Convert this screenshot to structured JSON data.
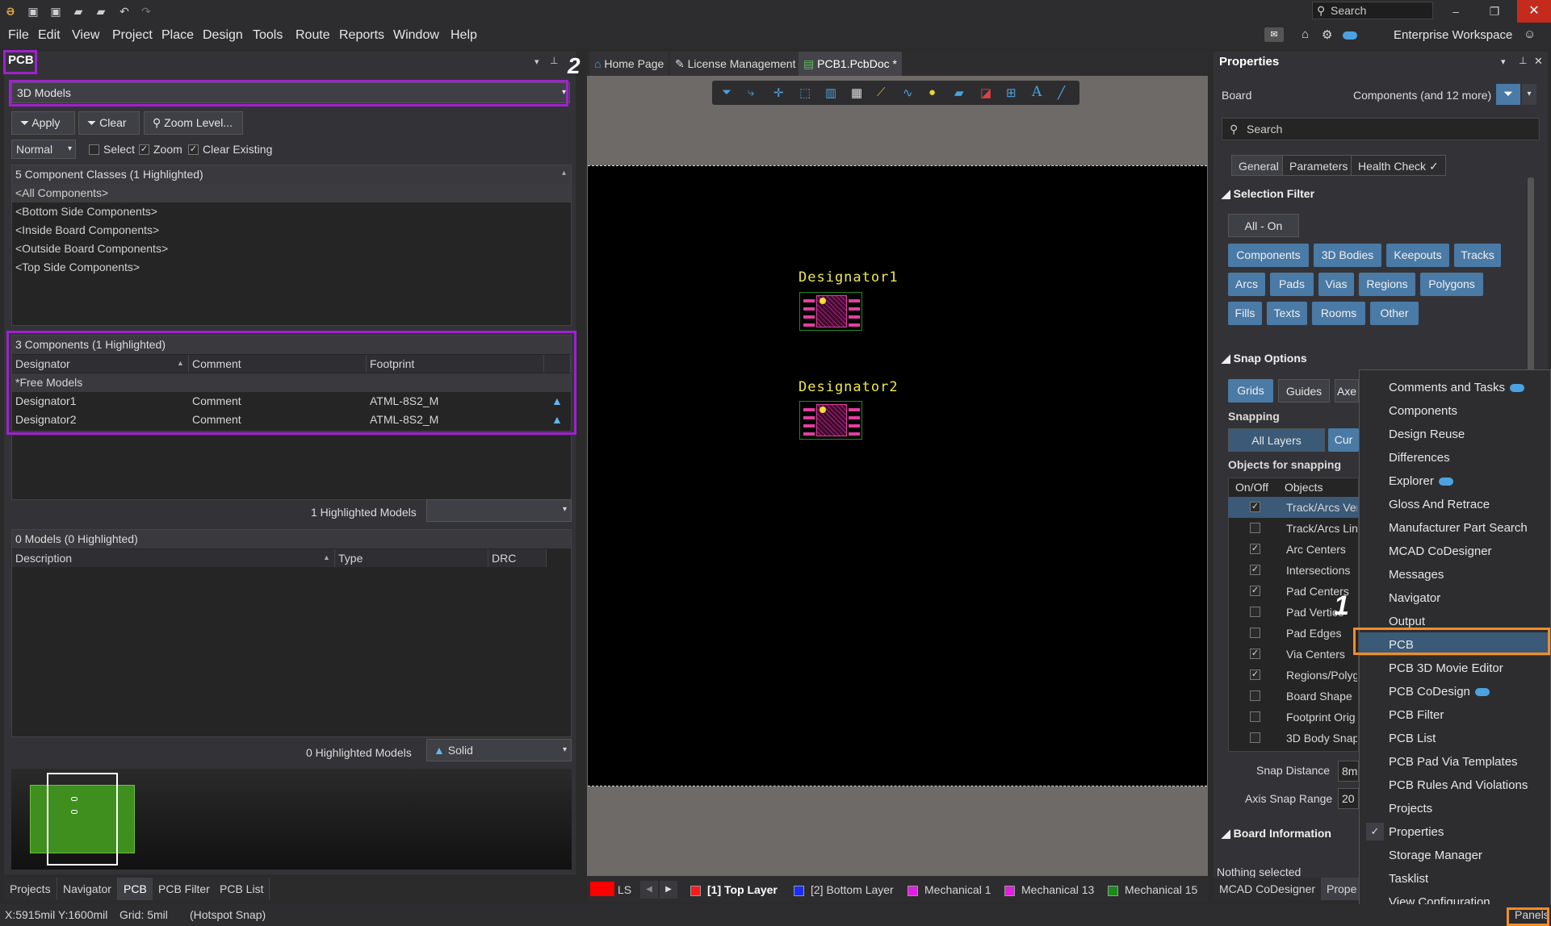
{
  "titlebar": {
    "search_placeholder": "Search"
  },
  "menu": [
    "File",
    "Edit",
    "View",
    "Project",
    "Place",
    "Design",
    "Tools",
    "Route",
    "Reports",
    "Window",
    "Help"
  ],
  "workspace": "Enterprise Workspace",
  "left_panel": {
    "title": "PCB",
    "mode": "3D Models",
    "apply": "Apply",
    "clear": "Clear",
    "zoom_level": "Zoom Level...",
    "normal": "Normal",
    "select": "Select",
    "zoom": "Zoom",
    "clear_existing": "Clear Existing",
    "classes_header": "5 Component Classes (1 Highlighted)",
    "classes": [
      "<All Components>",
      "<Bottom Side Components>",
      "<Inside Board Components>",
      "<Outside Board Components>",
      "<Top Side Components>"
    ],
    "components_header": "3 Components (1 Highlighted)",
    "columns": [
      "Designator",
      "Comment",
      "Footprint"
    ],
    "rows": [
      {
        "designator": "*Free Models",
        "comment": "",
        "footprint": ""
      },
      {
        "designator": "Designator1",
        "comment": "Comment",
        "footprint": "ATML-8S2_M"
      },
      {
        "designator": "Designator2",
        "comment": "Comment",
        "footprint": "ATML-8S2_M"
      }
    ],
    "highlighted_models": "1 Highlighted Models",
    "models_header": "0 Models (0 Highlighted)",
    "model_columns": [
      "Description",
      "Type",
      "DRC"
    ],
    "zero_highlighted": "0 Highlighted Models",
    "solid": "Solid",
    "tabs": [
      "Projects",
      "Navigator",
      "PCB",
      "PCB Filter",
      "PCB List"
    ]
  },
  "callouts": {
    "one": "1",
    "two": "2"
  },
  "doc_tabs": [
    "Home Page",
    "License Management",
    "PCB1.PcbDoc *"
  ],
  "canvas": {
    "designator1": "Designator1",
    "designator2": "Designator2"
  },
  "layers": {
    "ls": "LS",
    "items": [
      {
        "name": "[1] Top Layer",
        "color": "#ff1a1a"
      },
      {
        "name": "[2] Bottom Layer",
        "color": "#1a2dff"
      },
      {
        "name": "Mechanical 1",
        "color": "#e020e0"
      },
      {
        "name": "Mechanical 13",
        "color": "#e020e0"
      },
      {
        "name": "Mechanical 15",
        "color": "#1a8a1a"
      }
    ]
  },
  "properties": {
    "title": "Properties",
    "board": "Board",
    "filter_text": "Components (and 12 more)",
    "search_placeholder": "Search",
    "tabs": [
      "General",
      "Parameters",
      "Health Check"
    ],
    "selection_filter": "Selection Filter",
    "all_on": "All - On",
    "filters": [
      "Components",
      "3D Bodies",
      "Keepouts",
      "Tracks",
      "Arcs",
      "Pads",
      "Vias",
      "Regions",
      "Polygons",
      "Fills",
      "Texts",
      "Rooms",
      "Other"
    ],
    "snap_options": "Snap Options",
    "snap_buttons": [
      "Grids",
      "Guides",
      "Axe"
    ],
    "snapping": "Snapping",
    "all_layers": "All Layers",
    "cur": "Cur",
    "objects_for_snapping": "Objects for snapping",
    "onoff": "On/Off",
    "objects": "Objects",
    "snap_objects": [
      {
        "name": "Track/Arcs Vert",
        "on": true
      },
      {
        "name": "Track/Arcs Line",
        "on": false
      },
      {
        "name": "Arc Centers",
        "on": true
      },
      {
        "name": "Intersections",
        "on": true
      },
      {
        "name": "Pad Centers",
        "on": true
      },
      {
        "name": "Pad Vertice",
        "on": false
      },
      {
        "name": "Pad Edges",
        "on": false
      },
      {
        "name": "Via Centers",
        "on": true
      },
      {
        "name": "Regions/Polygo",
        "on": true
      },
      {
        "name": "Board Shape",
        "on": false
      },
      {
        "name": "Footprint Orig",
        "on": false
      },
      {
        "name": "3D Body Snap",
        "on": false
      }
    ],
    "snap_distance": "Snap Distance",
    "snap_distance_val": "8m",
    "axis_snap_range": "Axis Snap Range",
    "axis_snap_val": "20",
    "board_information": "Board Information",
    "nothing_selected": "Nothing selected",
    "bottom_tabs": [
      "MCAD CoDesigner",
      "Prope"
    ]
  },
  "panels_menu": [
    {
      "label": "Comments and Tasks",
      "cloud": true
    },
    {
      "label": "Components"
    },
    {
      "label": "Design Reuse"
    },
    {
      "label": "Differences"
    },
    {
      "label": "Explorer",
      "cloud": true
    },
    {
      "label": "Gloss And Retrace"
    },
    {
      "label": "Manufacturer Part Search"
    },
    {
      "label": "MCAD CoDesigner"
    },
    {
      "label": "Messages"
    },
    {
      "label": "Navigator"
    },
    {
      "label": "Output"
    },
    {
      "label": "PCB",
      "checked": true
    },
    {
      "label": "PCB 3D Movie Editor"
    },
    {
      "label": "PCB CoDesign",
      "cloud": true
    },
    {
      "label": "PCB Filter"
    },
    {
      "label": "PCB List"
    },
    {
      "label": "PCB Pad Via Templates"
    },
    {
      "label": "PCB Rules And Violations"
    },
    {
      "label": "Projects"
    },
    {
      "label": "Properties",
      "checked": true
    },
    {
      "label": "Storage Manager"
    },
    {
      "label": "Tasklist"
    },
    {
      "label": "View Configuration"
    }
  ],
  "status": {
    "coords": "X:5915mil Y:1600mil",
    "grid": "Grid: 5mil",
    "snap": "(Hotspot Snap)",
    "panels": "Panels"
  }
}
